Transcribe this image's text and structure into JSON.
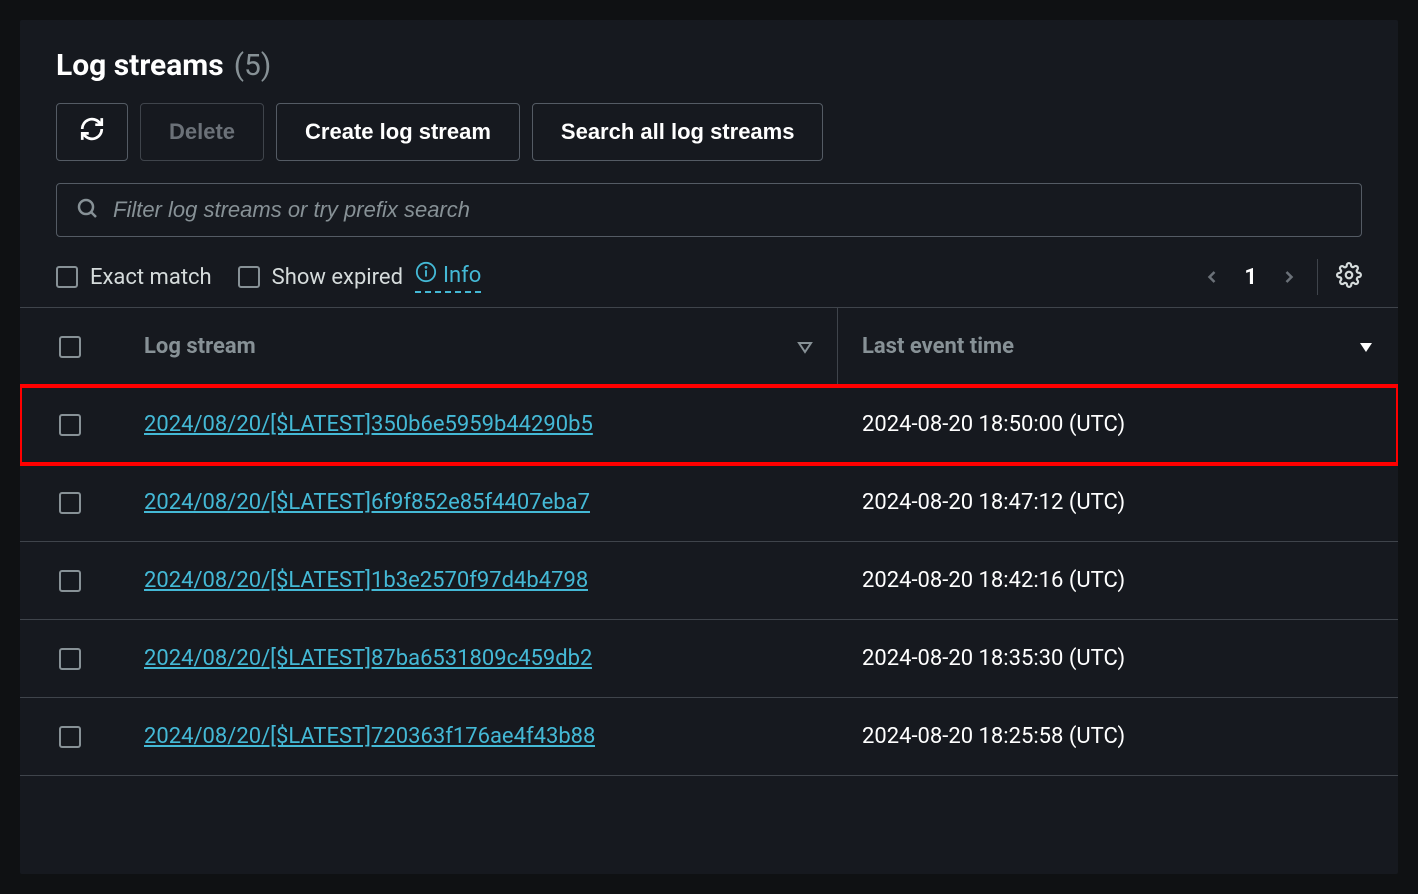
{
  "title": "Log streams",
  "count": "(5)",
  "toolbar": {
    "refresh_label": "Refresh",
    "delete_label": "Delete",
    "create_label": "Create log stream",
    "search_all_label": "Search all log streams"
  },
  "search": {
    "placeholder": "Filter log streams or try prefix search"
  },
  "filters": {
    "exact_match_label": "Exact match",
    "show_expired_label": "Show expired",
    "info_label": "Info"
  },
  "pagination": {
    "page": "1"
  },
  "table": {
    "columns": {
      "log_stream": "Log stream",
      "last_event": "Last event time"
    },
    "rows": [
      {
        "name": "2024/08/20/[$LATEST]350b6e5959b44290b5",
        "time": "2024-08-20 18:50:00 (UTC)",
        "highlighted": true
      },
      {
        "name": "2024/08/20/[$LATEST]6f9f852e85f4407eba7",
        "time": "2024-08-20 18:47:12 (UTC)",
        "highlighted": false
      },
      {
        "name": "2024/08/20/[$LATEST]1b3e2570f97d4b4798",
        "time": "2024-08-20 18:42:16 (UTC)",
        "highlighted": false
      },
      {
        "name": "2024/08/20/[$LATEST]87ba6531809c459db2",
        "time": "2024-08-20 18:35:30 (UTC)",
        "highlighted": false
      },
      {
        "name": "2024/08/20/[$LATEST]720363f176ae4f43b88",
        "time": "2024-08-20 18:25:58 (UTC)",
        "highlighted": false
      }
    ]
  }
}
